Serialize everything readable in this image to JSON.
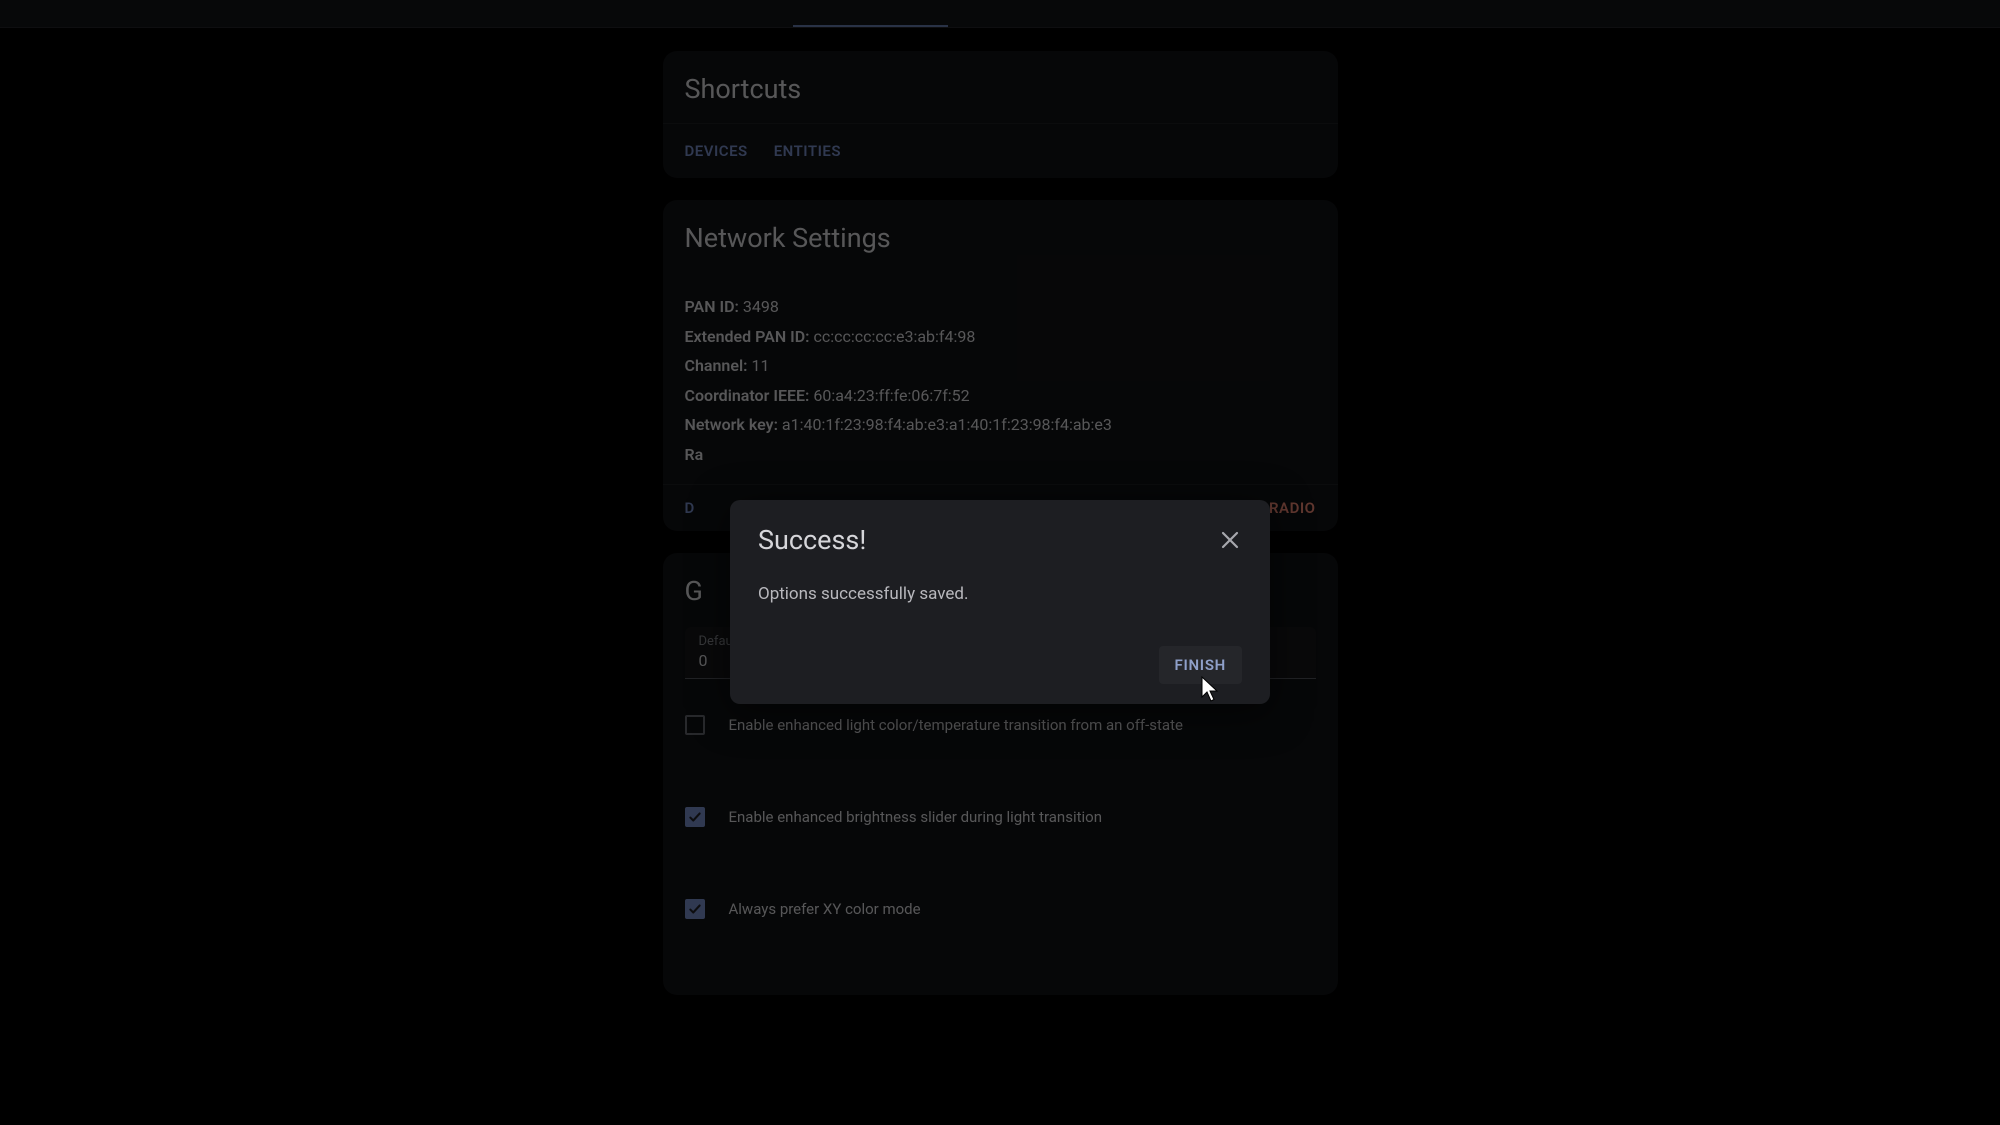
{
  "shortcuts": {
    "title": "Shortcuts",
    "chips": {
      "devices": "DEVICES",
      "entities": "ENTITIES"
    }
  },
  "network": {
    "title": "Network Settings",
    "labels": {
      "pan_id": "PAN ID:",
      "ext_pan_id": "Extended PAN ID:",
      "channel": "Channel:",
      "coord_ieee": "Coordinator IEEE:",
      "network_key": "Network key:",
      "ra_prefix": "Ra"
    },
    "values": {
      "pan_id": "3498",
      "ext_pan_id": "cc:cc:cc:cc:e3:ab:f4:98",
      "channel": "11",
      "coord_ieee": "60:a4:23:ff:fe:06:7f:52",
      "network_key": "a1:40:1f:23:98:f4:ab:e3:a1:40:1f:23:98:f4:ab:e3"
    },
    "actions": {
      "delete_prefix": "D",
      "radio": "RADIO"
    }
  },
  "global": {
    "title_prefix": "G",
    "transition": {
      "label": "Default light transition time (seconds)",
      "value": "0"
    },
    "options": {
      "enhanced_color": {
        "label": "Enable enhanced light color/temperature transition from an off-state",
        "checked": false
      },
      "enhanced_brightness": {
        "label": "Enable enhanced brightness slider during light transition",
        "checked": true
      },
      "prefer_xy": {
        "label": "Always prefer XY color mode",
        "checked": true
      }
    }
  },
  "dialog": {
    "title": "Success!",
    "body": "Options successfully saved.",
    "finish": "FINISH"
  }
}
